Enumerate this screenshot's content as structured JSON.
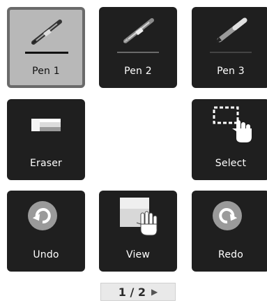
{
  "tools": {
    "pen1": {
      "label": "Pen 1",
      "selected": true
    },
    "pen2": {
      "label": "Pen 2"
    },
    "pen3": {
      "label": "Pen 3"
    },
    "eraser": {
      "label": "Eraser"
    },
    "select": {
      "label": "Select"
    },
    "undo": {
      "label": "Undo"
    },
    "view": {
      "label": "View"
    },
    "redo": {
      "label": "Redo"
    }
  },
  "pager": {
    "text": "1 / 2",
    "next_glyph": "▶"
  },
  "icons": {
    "pen1": "pen-icon",
    "pen2": "pen-icon",
    "pen3": "marker-icon",
    "eraser": "eraser-icon",
    "select": "select-hand-icon",
    "undo": "undo-icon",
    "view": "view-hand-icon",
    "redo": "redo-icon"
  },
  "colors": {
    "tile_bg": "#1f1f1f",
    "tile_selected_bg": "#b8b8b8",
    "tile_selected_border": "#6a6a6a"
  }
}
